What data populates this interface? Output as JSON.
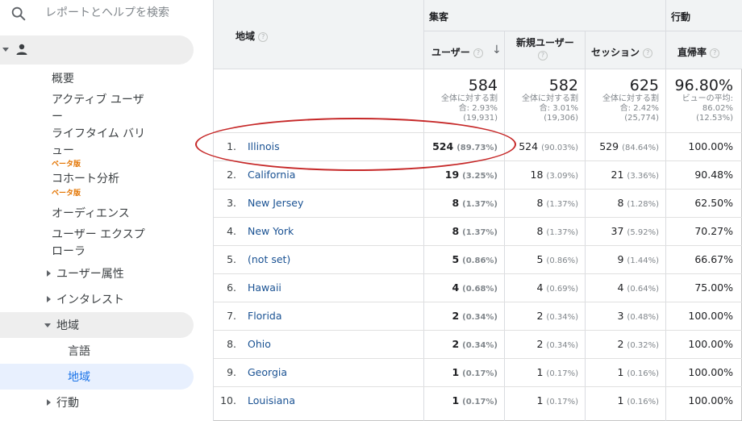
{
  "sidebar": {
    "search_placeholder": "レポートとヘルプを検索",
    "audience_label": "オーディエンス",
    "items": {
      "overview": "概要",
      "active_users_1": "アクティブ ユーザ",
      "active_users_2": "ー",
      "lifetime_value_1": "ライフタイム バリ",
      "lifetime_value_2": "ュー",
      "beta": "ベータ版",
      "cohort": "コホート分析",
      "audiences": "オーディエンス",
      "user_explorer_1": "ユーザー エクスプ",
      "user_explorer_2": "ローラ",
      "demographics": "ユーザー属性",
      "interests": "インタレスト",
      "geo": "地域",
      "language": "言語",
      "location": "地域",
      "behavior": "行動"
    }
  },
  "table": {
    "dimension_header": "地域",
    "group_acquisition": "集客",
    "group_behavior": "行動",
    "columns": {
      "users": "ユーザー",
      "new_users": "新規ユーザー",
      "sessions": "セッション",
      "bounce_rate": "直帰率"
    },
    "help_glyph": "?",
    "sort_glyph": "↓",
    "totals": {
      "users": {
        "value": "584",
        "l1": "全体に対する割",
        "l2": "合: 2.93%",
        "l3": "(19,931)"
      },
      "new_users": {
        "value": "582",
        "l1": "全体に対する割",
        "l2": "合: 3.01%",
        "l3": "(19,306)"
      },
      "sessions": {
        "value": "625",
        "l1": "全体に対する割",
        "l2": "合: 2.42%",
        "l3": "(25,774)"
      },
      "bounce_rate": {
        "value": "96.80%",
        "l1": "ビューの平均:",
        "l2": "86.02%",
        "l3": "(12.53%)"
      }
    },
    "rows": [
      {
        "num": "1.",
        "name": "Illinois",
        "users": "524",
        "users_pct": "(89.73%)",
        "new_users": "524",
        "new_users_pct": "(90.03%)",
        "sessions": "529",
        "sessions_pct": "(84.64%)",
        "bounce": "100.00%"
      },
      {
        "num": "2.",
        "name": "California",
        "users": "19",
        "users_pct": "(3.25%)",
        "new_users": "18",
        "new_users_pct": "(3.09%)",
        "sessions": "21",
        "sessions_pct": "(3.36%)",
        "bounce": "90.48%"
      },
      {
        "num": "3.",
        "name": "New Jersey",
        "users": "8",
        "users_pct": "(1.37%)",
        "new_users": "8",
        "new_users_pct": "(1.37%)",
        "sessions": "8",
        "sessions_pct": "(1.28%)",
        "bounce": "62.50%"
      },
      {
        "num": "4.",
        "name": "New York",
        "users": "8",
        "users_pct": "(1.37%)",
        "new_users": "8",
        "new_users_pct": "(1.37%)",
        "sessions": "37",
        "sessions_pct": "(5.92%)",
        "bounce": "70.27%"
      },
      {
        "num": "5.",
        "name": "(not set)",
        "users": "5",
        "users_pct": "(0.86%)",
        "new_users": "5",
        "new_users_pct": "(0.86%)",
        "sessions": "9",
        "sessions_pct": "(1.44%)",
        "bounce": "66.67%"
      },
      {
        "num": "6.",
        "name": "Hawaii",
        "users": "4",
        "users_pct": "(0.68%)",
        "new_users": "4",
        "new_users_pct": "(0.69%)",
        "sessions": "4",
        "sessions_pct": "(0.64%)",
        "bounce": "75.00%"
      },
      {
        "num": "7.",
        "name": "Florida",
        "users": "2",
        "users_pct": "(0.34%)",
        "new_users": "2",
        "new_users_pct": "(0.34%)",
        "sessions": "3",
        "sessions_pct": "(0.48%)",
        "bounce": "100.00%"
      },
      {
        "num": "8.",
        "name": "Ohio",
        "users": "2",
        "users_pct": "(0.34%)",
        "new_users": "2",
        "new_users_pct": "(0.34%)",
        "sessions": "2",
        "sessions_pct": "(0.32%)",
        "bounce": "100.00%"
      },
      {
        "num": "9.",
        "name": "Georgia",
        "users": "1",
        "users_pct": "(0.17%)",
        "new_users": "1",
        "new_users_pct": "(0.17%)",
        "sessions": "1",
        "sessions_pct": "(0.16%)",
        "bounce": "100.00%"
      },
      {
        "num": "10.",
        "name": "Louisiana",
        "users": "1",
        "users_pct": "(0.17%)",
        "new_users": "1",
        "new_users_pct": "(0.17%)",
        "sessions": "1",
        "sessions_pct": "(0.16%)",
        "bounce": "100.00%"
      }
    ]
  },
  "colors": {
    "link": "#1a5293",
    "selected": "#1a73e8",
    "beta": "#e37400",
    "annotation": "#c62828"
  }
}
